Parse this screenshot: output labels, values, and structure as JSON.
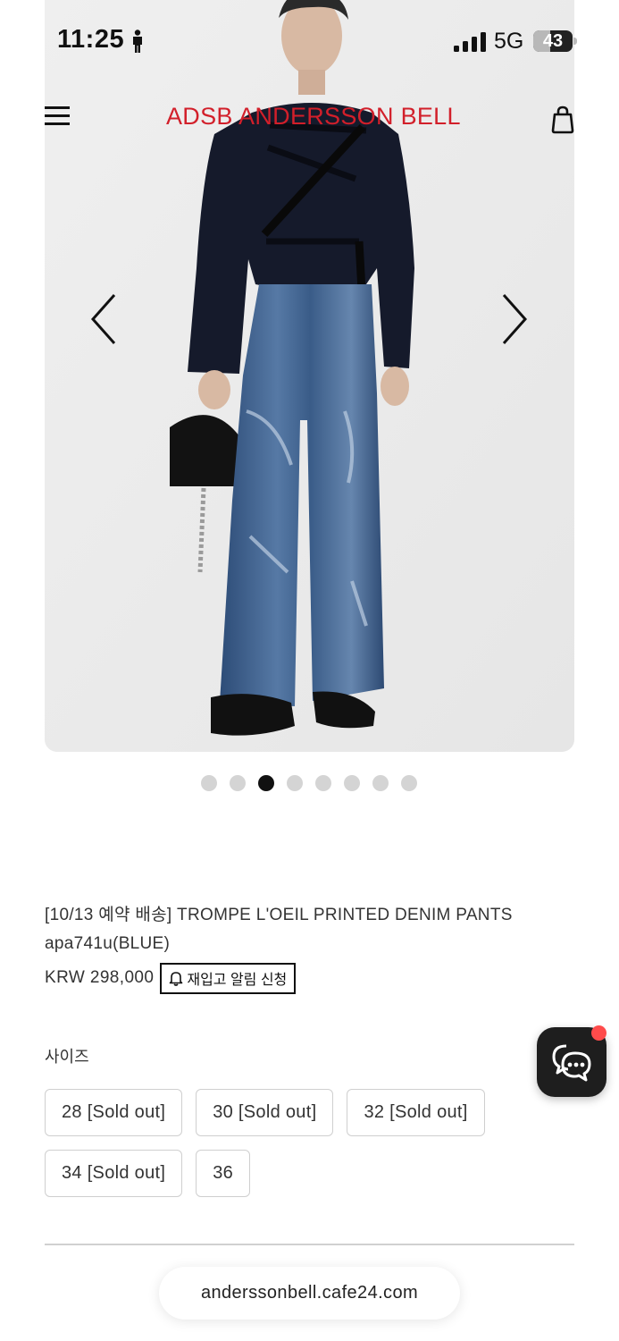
{
  "status_bar": {
    "time": "11:25",
    "network": "5G",
    "battery_level": "43",
    "battery_fraction": 0.43,
    "icons": [
      "person-icon",
      "signal-icon",
      "battery-icon"
    ]
  },
  "header": {
    "brand": "ADSB ANDERSSON BELL",
    "brand_color": "#d21f2a",
    "icons": [
      "menu-icon",
      "cart-icon"
    ]
  },
  "gallery": {
    "image_count": 8,
    "active_index": 2,
    "icons": [
      "chevron-left-icon",
      "chevron-right-icon"
    ]
  },
  "product": {
    "title": "[10/13 예약 배송] TROMPE L'OEIL PRINTED DENIM PANTS apa741u(BLUE)",
    "price": "KRW 298,000",
    "restock_button": "재입고 알림 신청",
    "size_label": "사이즈",
    "sizes": [
      "28 [Sold out]",
      "30 [Sold out]",
      "32 [Sold out]",
      "34 [Sold out]",
      "36"
    ]
  },
  "chat": {
    "icon": "chat-icon",
    "badge_color": "#ff4b4b"
  },
  "browser": {
    "url": "anderssonbell.cafe24.com"
  }
}
